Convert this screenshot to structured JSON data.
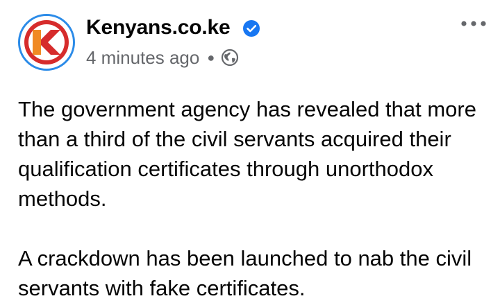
{
  "post": {
    "page_name": "Kenyans.co.ke",
    "verified": true,
    "timestamp": "4 minutes ago",
    "audience_icon": "globe-icon",
    "more_icon": "ellipsis-icon",
    "paragraphs": [
      "The government agency has revealed that more\nthan a third of the civil servants acquired their\nqualification certificates through unorthodox\nmethods.",
      "A crackdown has been launched to nab the civil\nservants with fake certificates."
    ]
  },
  "avatar": {
    "letter": "K",
    "ring_color": "#2b8be8",
    "brand_red": "#d62c2c",
    "brand_orange": "#f08a24"
  },
  "colors": {
    "verified_badge": "#1877f2",
    "secondary_text": "#65676b",
    "primary_text": "#050505"
  }
}
